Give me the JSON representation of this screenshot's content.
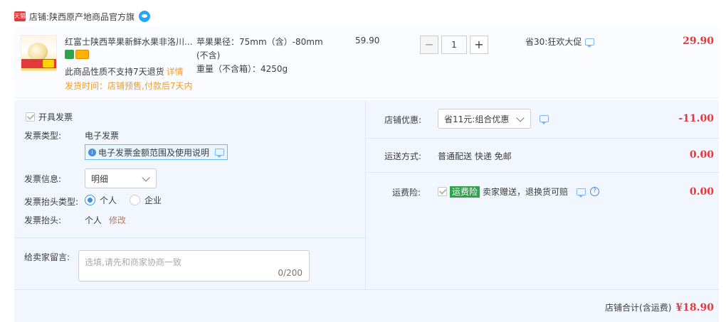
{
  "store": {
    "badge": "天猫",
    "label": "店铺:",
    "name": "陕西原产地商品官方旗"
  },
  "item": {
    "title": "红富士陕西苹果新鲜水果非洛川...",
    "return_note": "此商品性质不支持7天退货",
    "detail_link": "详情",
    "ship_time": "发货时间：店铺预售,付款后7天内",
    "sku_line1": "苹果果径：75mm（含）-80mm",
    "sku_line2": "(不含)",
    "sku_line3": "重量（不含箱）：4250g",
    "unit_price": "59.90",
    "quantity": "1",
    "minus": "−",
    "plus": "+",
    "promo": "省30:狂欢大促",
    "total": "29.90"
  },
  "invoice": {
    "open_label": "开具发票",
    "type_label": "发票类型:",
    "type_value": "电子发票",
    "help_text": "电子发票金额范围及使用说明",
    "info_label": "发票信息:",
    "info_value": "明细",
    "title_type_label": "发票抬头类型:",
    "opt_personal": "个人",
    "opt_company": "企业",
    "title_label": "发票抬头:",
    "title_value": "个人",
    "modify": "修改"
  },
  "memo": {
    "label": "给卖家留言:",
    "placeholder": "选填,请先和商家协商一致",
    "count": "0/200"
  },
  "order": {
    "discount_label": "店铺优惠:",
    "discount_value": "省11元:组合优惠",
    "discount_amount": "-11.00",
    "shipping_label": "运送方式:",
    "shipping_value": "普通配送 快递 免邮",
    "shipping_amount": "0.00",
    "insurance_label": "运费险:",
    "insurance_tag": "运费险",
    "insurance_value": "卖家赠送，退换货可赔",
    "insurance_help": "?",
    "insurance_amount": "0.00",
    "total_label": "店铺合计(含运费)",
    "total_amount": "¥18.90"
  },
  "colors": {
    "price_red": "#e4393c",
    "link_orange": "#f29c28",
    "panel_bg": "#f2f7ff",
    "accent_blue": "#3b8df0",
    "insurance_green": "#2fa34b"
  }
}
